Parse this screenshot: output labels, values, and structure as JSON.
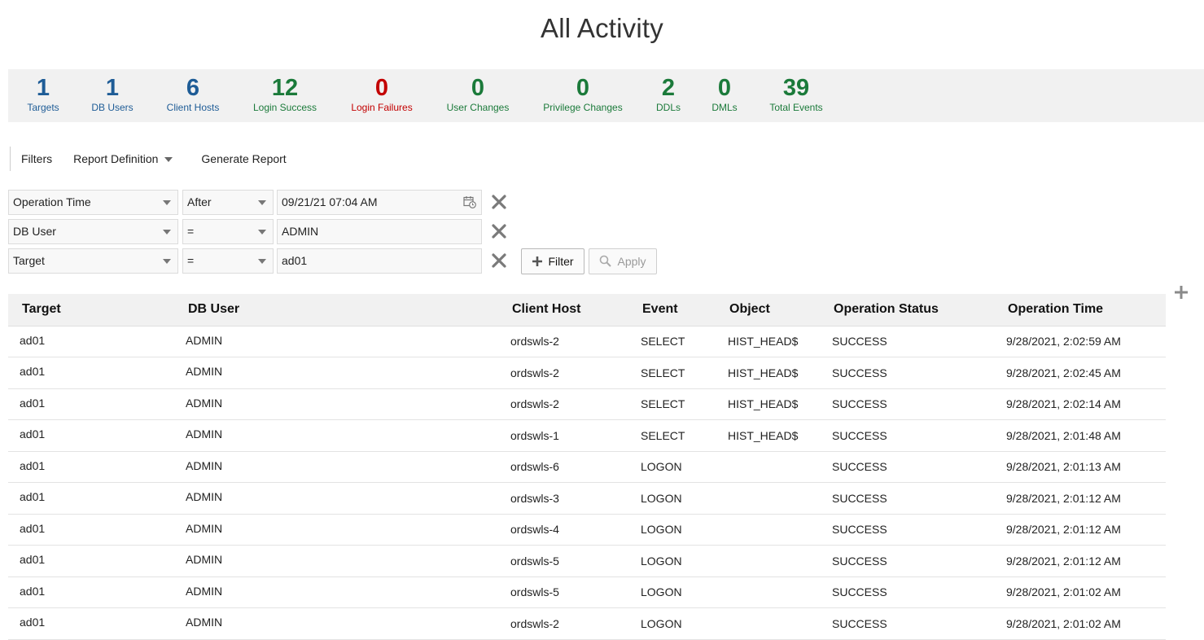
{
  "page": {
    "title": "All Activity"
  },
  "summary": [
    {
      "value": "1",
      "label": "Targets",
      "color": "#1e5c96"
    },
    {
      "value": "1",
      "label": "DB Users",
      "color": "#1e5c96"
    },
    {
      "value": "6",
      "label": "Client Hosts",
      "color": "#1e5c96"
    },
    {
      "value": "12",
      "label": "Login Success",
      "color": "#1b7a3a"
    },
    {
      "value": "0",
      "label": "Login Failures",
      "color": "#c30000"
    },
    {
      "value": "0",
      "label": "User Changes",
      "color": "#1b7a3a"
    },
    {
      "value": "0",
      "label": "Privilege Changes",
      "color": "#1b7a3a"
    },
    {
      "value": "2",
      "label": "DDLs",
      "color": "#1b7a3a"
    },
    {
      "value": "0",
      "label": "DMLs",
      "color": "#1b7a3a"
    },
    {
      "value": "39",
      "label": "Total Events",
      "color": "#1b7a3a"
    }
  ],
  "toolbar": {
    "filters": "Filters",
    "report_definition": "Report Definition",
    "generate_report": "Generate Report"
  },
  "filters": [
    {
      "field": "Operation Time",
      "operator": "After",
      "value": "09/21/21 07:04 AM"
    },
    {
      "field": "DB User",
      "operator": "=",
      "value": "ADMIN"
    },
    {
      "field": "Target",
      "operator": "=",
      "value": "ad01"
    }
  ],
  "buttons": {
    "add_filter": "Filter",
    "apply": "Apply"
  },
  "table": {
    "columns": [
      "Target",
      "DB User",
      "Client Host",
      "Event",
      "Object",
      "Operation Status",
      "Operation Time"
    ],
    "rows": [
      [
        "ad01",
        "ADMIN",
        "ordswls-2",
        "SELECT",
        "HIST_HEAD$",
        "SUCCESS",
        "9/28/2021, 2:02:59 AM"
      ],
      [
        "ad01",
        "ADMIN",
        "ordswls-2",
        "SELECT",
        "HIST_HEAD$",
        "SUCCESS",
        "9/28/2021, 2:02:45 AM"
      ],
      [
        "ad01",
        "ADMIN",
        "ordswls-2",
        "SELECT",
        "HIST_HEAD$",
        "SUCCESS",
        "9/28/2021, 2:02:14 AM"
      ],
      [
        "ad01",
        "ADMIN",
        "ordswls-1",
        "SELECT",
        "HIST_HEAD$",
        "SUCCESS",
        "9/28/2021, 2:01:48 AM"
      ],
      [
        "ad01",
        "ADMIN",
        "ordswls-6",
        "LOGON",
        "",
        "SUCCESS",
        "9/28/2021, 2:01:13 AM"
      ],
      [
        "ad01",
        "ADMIN",
        "ordswls-3",
        "LOGON",
        "",
        "SUCCESS",
        "9/28/2021, 2:01:12 AM"
      ],
      [
        "ad01",
        "ADMIN",
        "ordswls-4",
        "LOGON",
        "",
        "SUCCESS",
        "9/28/2021, 2:01:12 AM"
      ],
      [
        "ad01",
        "ADMIN",
        "ordswls-5",
        "LOGON",
        "",
        "SUCCESS",
        "9/28/2021, 2:01:12 AM"
      ],
      [
        "ad01",
        "ADMIN",
        "ordswls-5",
        "LOGON",
        "",
        "SUCCESS",
        "9/28/2021, 2:01:02 AM"
      ],
      [
        "ad01",
        "ADMIN",
        "ordswls-2",
        "LOGON",
        "",
        "SUCCESS",
        "9/28/2021, 2:01:02 AM"
      ]
    ]
  }
}
